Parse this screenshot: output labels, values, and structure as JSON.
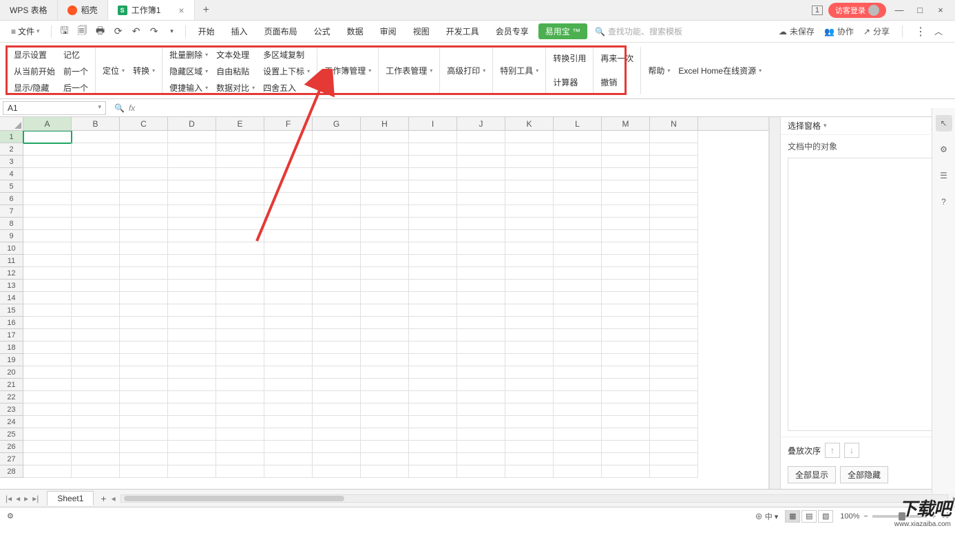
{
  "titlebar": {
    "app_tab": "WPS 表格",
    "doc_tab1": "稻壳",
    "doc_tab2": "工作簿1",
    "badge": "1",
    "login": "访客登录"
  },
  "menubar": {
    "file": "文件",
    "items": [
      "开始",
      "插入",
      "页面布局",
      "公式",
      "数据",
      "审阅",
      "视图",
      "开发工具",
      "会员专享"
    ],
    "green": "易用宝 ™",
    "search_placeholder": "查找功能、搜索模板",
    "unsaved": "未保存",
    "coop": "协作",
    "share": "分享"
  },
  "ribbon": {
    "g1": [
      "显示设置",
      "从当前开始",
      "显示/隐藏"
    ],
    "g2": [
      "记忆",
      "前一个",
      "后一个"
    ],
    "g3a": "定位",
    "g3b": "转换",
    "g4": [
      "批量删除",
      "隐藏区域",
      "便捷输入"
    ],
    "g5": [
      "文本处理",
      "自由粘贴",
      "数据对比"
    ],
    "g6": [
      "多区域复制",
      "设置上下标",
      "四舍五入"
    ],
    "g7": "工作簿管理",
    "g8": "工作表管理",
    "g9": "高级打印",
    "g10": "特别工具",
    "g11": [
      "转换引用",
      "计算器"
    ],
    "g12": [
      "再来一次",
      "撤销"
    ],
    "g13": "帮助",
    "g14": "Excel Home在线资源"
  },
  "fbar": {
    "name": "A1"
  },
  "grid": {
    "cols": [
      "A",
      "B",
      "C",
      "D",
      "E",
      "F",
      "G",
      "H",
      "I",
      "J",
      "K",
      "L",
      "M",
      "N"
    ],
    "rows": 28
  },
  "rightpanel": {
    "title": "选择窗格",
    "label": "文档中的对象",
    "order": "叠放次序",
    "show_all": "全部显示",
    "hide_all": "全部隐藏"
  },
  "sheet": {
    "name": "Sheet1"
  },
  "status": {
    "ime": "中",
    "zoom": "100%"
  },
  "watermark": {
    "main": "下载吧",
    "sub": "www.xiazaiba.com"
  }
}
